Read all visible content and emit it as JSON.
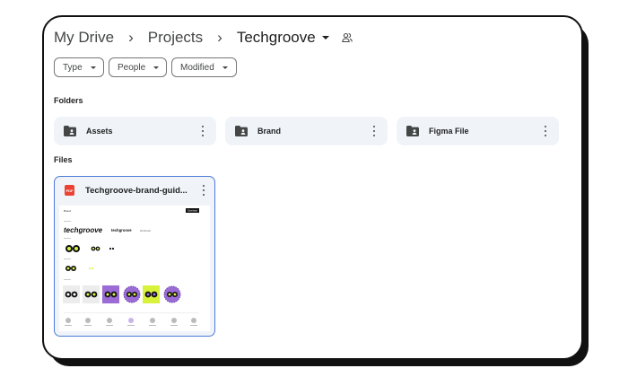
{
  "breadcrumb": {
    "items": [
      "My Drive",
      "Projects",
      "Techgroove"
    ],
    "separator": "›"
  },
  "filters": {
    "type": "Type",
    "people": "People",
    "modified": "Modified"
  },
  "sections": {
    "folders": "Folders",
    "files": "Files"
  },
  "folders": [
    {
      "name": "Assets",
      "icon": "shared-folder-icon"
    },
    {
      "name": "Brand",
      "icon": "shared-folder-icon"
    },
    {
      "name": "Figma File",
      "icon": "shared-folder-icon"
    }
  ],
  "files": [
    {
      "name": "Techgroove-brand-guid...",
      "icon": "pdf-icon",
      "icon_label": "PDF",
      "thumbnail": {
        "header_left": "Brand",
        "header_button": "Download",
        "logo_text": "techgroove",
        "logo_small": "techgroove",
        "logo_tag": "Wordmark"
      }
    }
  ],
  "colors": {
    "folder_bg": "#f0f4f9",
    "selected_border": "#4c7bd9",
    "pdf_red": "#ea4335",
    "mascot_purple": "#9b6bd6",
    "mascot_lime": "#d8f23c"
  }
}
